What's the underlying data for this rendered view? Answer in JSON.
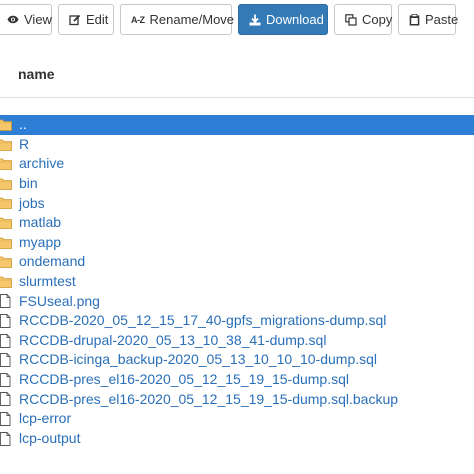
{
  "toolbar": {
    "view_label": "View",
    "edit_label": "Edit",
    "rename_icon_text": "A-Z",
    "rename_label": "Rename/Move",
    "download_label": "Download",
    "copy_label": "Copy",
    "paste_label": "Paste"
  },
  "table": {
    "name_header": "name"
  },
  "colors": {
    "primary": "#337ab7",
    "selected_row": "#2d7fd6",
    "link": "#2a6fb8",
    "folder": "#f5c66a"
  },
  "files": [
    {
      "name": "..",
      "type": "folder",
      "selected": true
    },
    {
      "name": "R",
      "type": "folder"
    },
    {
      "name": "archive",
      "type": "folder"
    },
    {
      "name": "bin",
      "type": "folder"
    },
    {
      "name": "jobs",
      "type": "folder"
    },
    {
      "name": "matlab",
      "type": "folder"
    },
    {
      "name": "myapp",
      "type": "folder"
    },
    {
      "name": "ondemand",
      "type": "folder"
    },
    {
      "name": "slurmtest",
      "type": "folder"
    },
    {
      "name": "FSUseal.png",
      "type": "file"
    },
    {
      "name": "RCCDB-2020_05_12_15_17_40-gpfs_migrations-dump.sql",
      "type": "file"
    },
    {
      "name": "RCCDB-drupal-2020_05_13_10_38_41-dump.sql",
      "type": "file"
    },
    {
      "name": "RCCDB-icinga_backup-2020_05_13_10_10_10-dump.sql",
      "type": "file"
    },
    {
      "name": "RCCDB-pres_el16-2020_05_12_15_19_15-dump.sql",
      "type": "file"
    },
    {
      "name": "RCCDB-pres_el16-2020_05_12_15_19_15-dump.sql.backup",
      "type": "file"
    },
    {
      "name": "lcp-error",
      "type": "file"
    },
    {
      "name": "lcp-output",
      "type": "file"
    }
  ]
}
